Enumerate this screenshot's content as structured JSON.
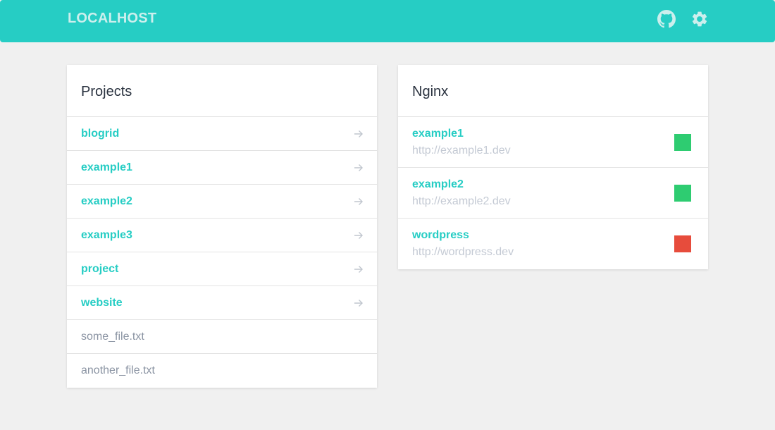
{
  "header": {
    "brand": "LOCALHOST",
    "icons": [
      "github-icon",
      "gear-icon"
    ],
    "color": "#26cdc4"
  },
  "projects": {
    "title": "Projects",
    "items": [
      {
        "label": "blogrid",
        "type": "dir"
      },
      {
        "label": "example1",
        "type": "dir"
      },
      {
        "label": "example2",
        "type": "dir"
      },
      {
        "label": "example3",
        "type": "dir"
      },
      {
        "label": "project",
        "type": "dir"
      },
      {
        "label": "website",
        "type": "dir"
      },
      {
        "label": "some_file.txt",
        "type": "file"
      },
      {
        "label": "another_file.txt",
        "type": "file"
      }
    ]
  },
  "nginx": {
    "title": "Nginx",
    "sites": [
      {
        "name": "example1",
        "url": "http://example1.dev",
        "status": "up",
        "status_color": "#2ecc71"
      },
      {
        "name": "example2",
        "url": "http://example2.dev",
        "status": "up",
        "status_color": "#2ecc71"
      },
      {
        "name": "wordpress",
        "url": "http://wordpress.dev",
        "status": "down",
        "status_color": "#e74c3c"
      }
    ]
  }
}
